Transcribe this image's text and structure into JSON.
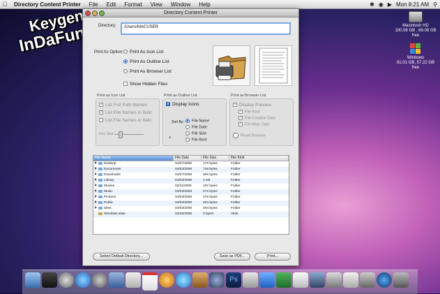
{
  "menubar": {
    "app_name": "Directory Content Printer",
    "items": [
      "File",
      "Edit",
      "Format",
      "View",
      "Window",
      "Help"
    ],
    "clock": "Mon 8:21 AM"
  },
  "desktop": {
    "icons": [
      {
        "name": "Macintosh HD",
        "sub": "100.56 GB , 69.08 GB free"
      },
      {
        "name": "Windows",
        "sub": "81.01 GB, 57.22 GB free"
      }
    ],
    "watermark": {
      "line1": "Keygen",
      "line2": "InDaFun.com"
    }
  },
  "window": {
    "title": "Directory Content Printer",
    "directory_label": "Directory:",
    "directory_value": "/Users/MACUSER",
    "print_as_label": "Print As Option:",
    "print_options": [
      "Print As Icon List",
      "Print As Outline List",
      "Print As Browser List"
    ],
    "selected_option": 1,
    "show_hidden": "Show Hidden Files",
    "icon_list": {
      "title": "Print as Icon List",
      "options": [
        "List Full Path Names",
        "List File Names in Bold",
        "List File Names in Italic"
      ],
      "icon_size_label": "Icon Size:"
    },
    "outline_list": {
      "title": "Print as Outline List",
      "display_icons": "Display Icons",
      "sort_by_label": "Sort By:",
      "sort_options": [
        "File Name",
        "File Date",
        "File Size",
        "File Kind"
      ]
    },
    "browser_list": {
      "title": "Print as Browser List",
      "display_preview": "Display Preview",
      "options": [
        "File Kind",
        "File Creation Date",
        "File Mod. Date"
      ],
      "reset": "Reset Browser"
    },
    "table": {
      "headers": [
        "File Name",
        "File Date",
        "File Size",
        "File Kind"
      ],
      "rows": [
        {
          "name": "Desktop",
          "date": "04/07/2008",
          "size": "170 bytes",
          "kind": "Folder"
        },
        {
          "name": "Documents",
          "date": "04/03/2008",
          "size": "748 bytes",
          "kind": "Folder"
        },
        {
          "name": "Downloads",
          "date": "04/07/2008",
          "size": "306 bytes",
          "kind": "Folder"
        },
        {
          "name": "Library",
          "date": "04/03/2008",
          "size": "1 KB",
          "kind": "Folder"
        },
        {
          "name": "Movies",
          "date": "03/11/2008",
          "size": "102 bytes",
          "kind": "Folder"
        },
        {
          "name": "Music",
          "date": "04/03/2008",
          "size": "272 bytes",
          "kind": "Folder"
        },
        {
          "name": "Pictures",
          "date": "04/03/2008",
          "size": "476 bytes",
          "kind": "Folder"
        },
        {
          "name": "Public",
          "date": "04/03/2008",
          "size": "204 bytes",
          "kind": "Folder"
        },
        {
          "name": "Sites",
          "date": "04/03/2008",
          "size": "204 bytes",
          "kind": "Folder"
        },
        {
          "name": "Windows alias",
          "date": "03/26/2008",
          "size": "0 bytes",
          "kind": "Alias"
        }
      ]
    },
    "buttons": {
      "select_default": "Select Default Directory...",
      "save_pdf": "Save as PDF...",
      "print": "Print..."
    }
  }
}
